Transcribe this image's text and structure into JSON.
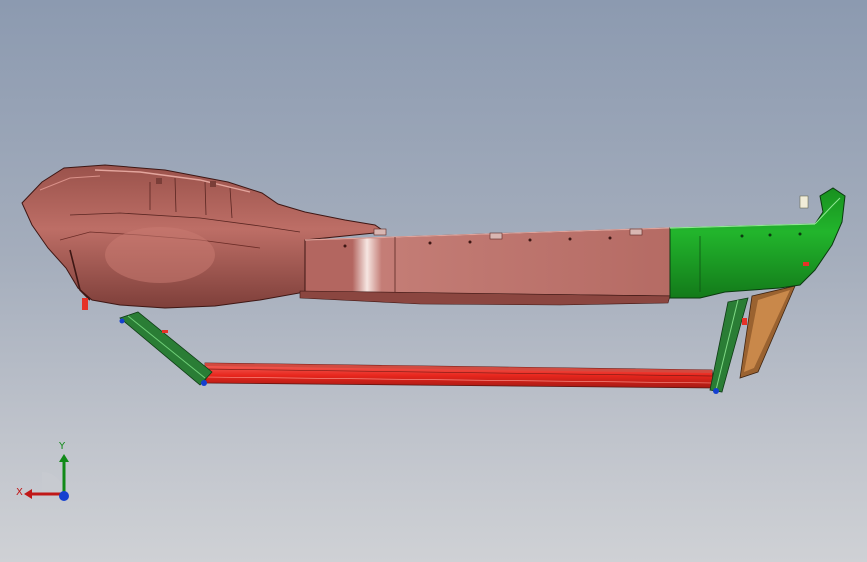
{
  "viewport": {
    "name": "3d-cad-viewport"
  },
  "triad": {
    "x_label": "X",
    "y_label": "Y"
  },
  "colors": {
    "background_top": "#8c9ab0",
    "background_bottom": "#cfd1d5",
    "body_part": "#b96a62",
    "body_part_dark": "#7a3e38",
    "green_part": "#1fa82b",
    "red_rail": "#e53228",
    "axis_x": "#c01818",
    "axis_y": "#118a18",
    "axis_z": "#1440d0"
  }
}
